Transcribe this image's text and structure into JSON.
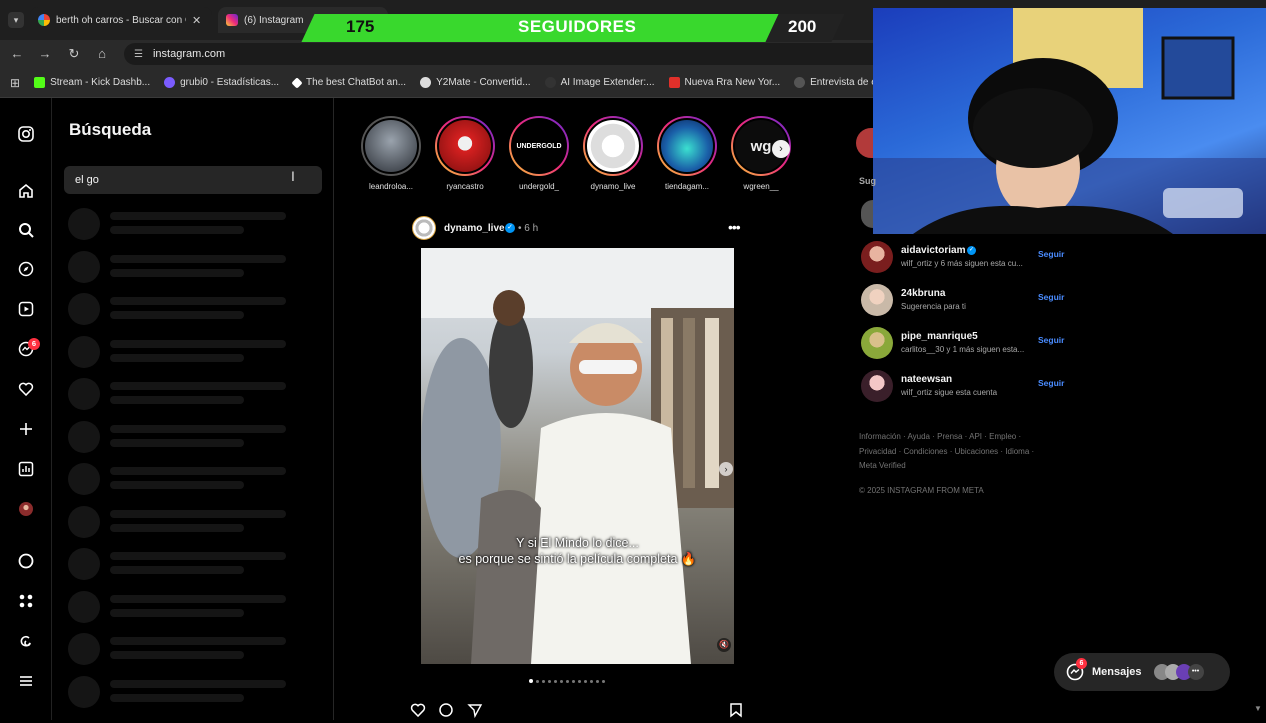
{
  "browser": {
    "tabs": [
      {
        "title": "berth oh carros - Buscar con Go",
        "active": false
      },
      {
        "title": "(6) Instagram",
        "active": true
      }
    ],
    "url": "instagram.com",
    "bookmarks": [
      "Stream - Kick Dashb...",
      "grubi0 - Estadísticas...",
      "The best ChatBot an...",
      "Y2Mate - Convertid...",
      "AI Image Extender:...",
      "Nueva Rra New Yor...",
      "Entrevista de empr"
    ]
  },
  "overlay": {
    "current": "175",
    "label": "SEGUIDORES",
    "goal": "200",
    "progress": 0.875,
    "color": "#39d82d"
  },
  "nav": {
    "notifications_badge": "6"
  },
  "search": {
    "title": "Búsqueda",
    "query": "el go"
  },
  "stories": [
    {
      "name": "leandroloa...",
      "inner": ""
    },
    {
      "name": "ryancastro",
      "inner": ""
    },
    {
      "name": "undergold_",
      "inner": "UNDERGOLD"
    },
    {
      "name": "dynamo_live",
      "inner": ""
    },
    {
      "name": "tiendagam...",
      "inner": ""
    },
    {
      "name": "wgreen__",
      "inner": "wg"
    }
  ],
  "post": {
    "username": "dynamo_live",
    "time": "• 6 h",
    "caption_line1": "Y si El Mindo lo dice...",
    "caption_line2": "es porque se sintió la película completa 🔥"
  },
  "suggestions": {
    "header": "Sug",
    "follow_label": "Seguir",
    "items": [
      {
        "username": "aidavictoriam",
        "sub": "wilf_ortiz y 6 más siguen esta cu...",
        "verified": true
      },
      {
        "username": "24kbruna",
        "sub": "Sugerencia para ti",
        "verified": false
      },
      {
        "username": "pipe_manrique5",
        "sub": "carlitos__30 y 1 más siguen esta...",
        "verified": false
      },
      {
        "username": "nateewsan",
        "sub": "wilf_ortiz sigue esta cuenta",
        "verified": false
      }
    ]
  },
  "footer": {
    "line1": "Información · Ayuda · Prensa · API · Empleo ·",
    "line2": "Privacidad · Condiciones · Ubicaciones · Idioma ·",
    "line3": "Meta Verified",
    "copyright": "© 2025 INSTAGRAM FROM META"
  },
  "messages": {
    "label": "Mensajes",
    "badge": "6"
  }
}
